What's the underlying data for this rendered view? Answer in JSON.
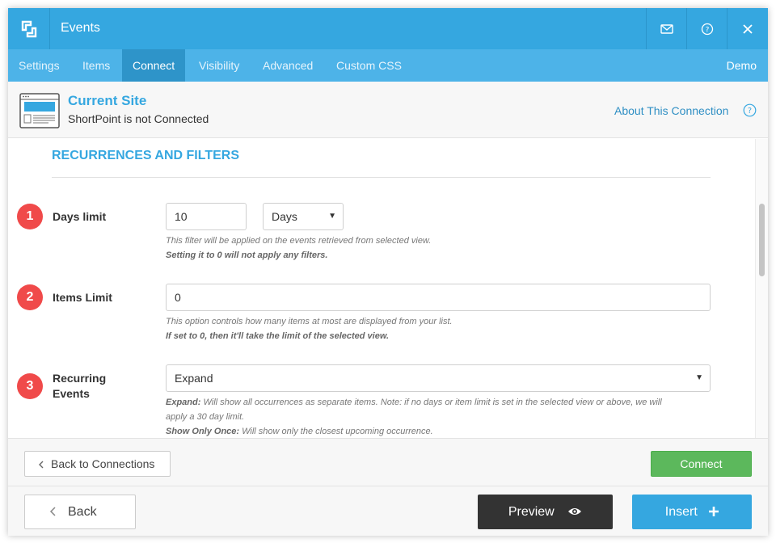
{
  "window": {
    "title": "Events"
  },
  "tabs": [
    {
      "label": "Settings"
    },
    {
      "label": "Items"
    },
    {
      "label": "Connect",
      "active": true
    },
    {
      "label": "Visibility"
    },
    {
      "label": "Advanced"
    },
    {
      "label": "Custom CSS"
    }
  ],
  "demo_label": "Demo",
  "site": {
    "title": "Current Site",
    "status": "ShortPoint is not Connected",
    "about_link": "About This Connection"
  },
  "section": {
    "title": "RECURRENCES AND FILTERS"
  },
  "fields": {
    "days_limit": {
      "number": "1",
      "label": "Days limit",
      "value": "10",
      "unit": "Days",
      "hint": "This filter will be applied on the events retrieved from selected view.",
      "hint_bold": "Setting it to 0 will not apply any filters."
    },
    "items_limit": {
      "number": "2",
      "label": "Items Limit",
      "value": "0",
      "hint": "This option controls how many items at most are displayed from your list.",
      "hint_bold": "If set to 0, then it'll take the limit of the selected view."
    },
    "recurring": {
      "number": "3",
      "label_line1": "Recurring",
      "label_line2": "Events",
      "value": "Expand",
      "hint1_bold": "Expand:",
      "hint1_line1": " Will show all occurrences as separate items. Note: if no days or item limit is set in the selected view or above, we will",
      "hint1_line2": "apply a 30 day limit.",
      "hint2_bold": "Show Only Once:",
      "hint2": " Will show only the closest upcoming occurrence."
    }
  },
  "footer": {
    "back_to_connections": "Back to Connections",
    "connect": "Connect",
    "back": "Back",
    "preview": "Preview",
    "insert": "Insert"
  },
  "colors": {
    "accent": "#35a7e0",
    "tabs_bg": "#4db3e8",
    "badge": "#f04a4a",
    "connect": "#5cb85c",
    "preview": "#333333"
  }
}
